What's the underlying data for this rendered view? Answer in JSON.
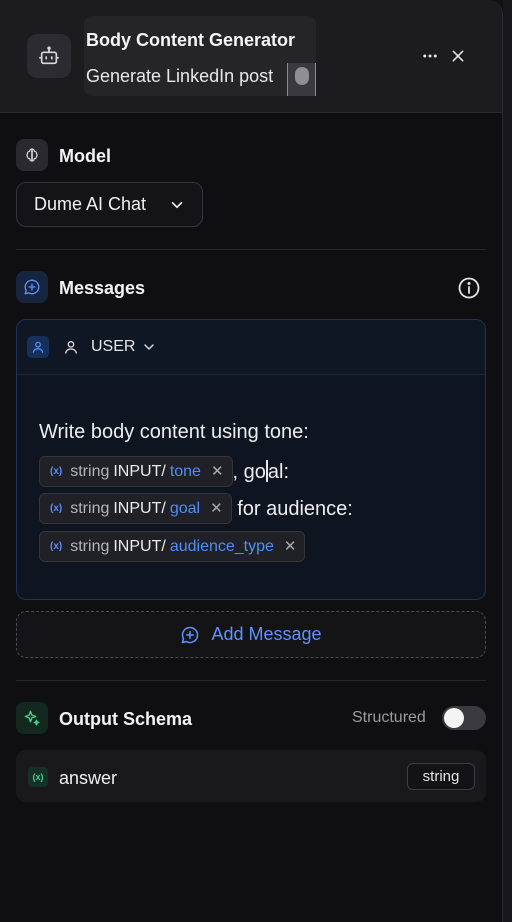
{
  "header": {
    "title": "Body Content Generator",
    "subtitle": "Generate LinkedIn post"
  },
  "model": {
    "section_label": "Model",
    "selected": "Dume AI Chat"
  },
  "messages": {
    "section_label": "Messages",
    "items": [
      {
        "role": "USER",
        "text_1": "Write body content using tone:",
        "text_2a": ", go",
        "text_2b": "al:",
        "text_3": "for audience:",
        "variables": [
          {
            "type": "string",
            "path": "INPUT/",
            "name": "tone"
          },
          {
            "type": "string",
            "path": "INPUT/",
            "name": "goal"
          },
          {
            "type": "string",
            "path": "INPUT/",
            "name": "audience_type"
          }
        ]
      }
    ],
    "add_label": "Add Message"
  },
  "output_schema": {
    "section_label": "Output Schema",
    "structured_label": "Structured",
    "structured_enabled": false,
    "fields": [
      {
        "name": "answer",
        "type": "string"
      }
    ]
  },
  "icons": {
    "node": "robot-icon",
    "more": "more-horizontal-icon",
    "close": "close-icon",
    "model": "brain-icon",
    "messages": "message-plus-icon",
    "info": "info-icon",
    "role": "user-icon",
    "variable": "variable-icon",
    "output": "sparkles-icon"
  },
  "colors": {
    "accent": "#5c93ff",
    "variable_name": "#4f8ef7",
    "output_accent": "#4ad08c"
  }
}
